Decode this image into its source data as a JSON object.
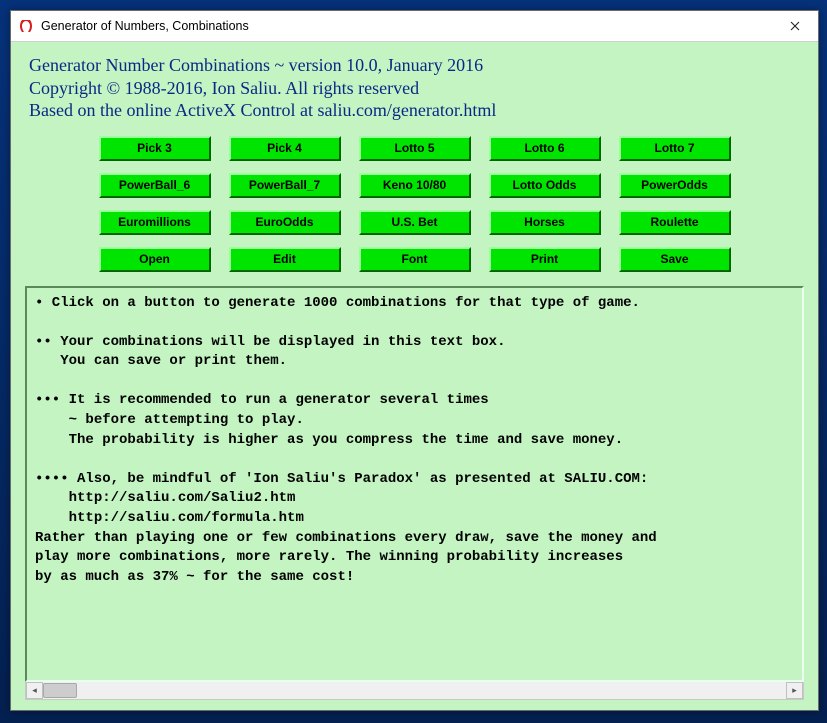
{
  "window": {
    "title": "Generator of Numbers, Combinations"
  },
  "header": {
    "line1": "Generator Number Combinations ~ version 10.0, January 2016",
    "line2": "Copyright © 1988-2016, Ion Saliu. All rights reserved",
    "line3": "Based on the online ActiveX Control at saliu.com/generator.html"
  },
  "buttons": {
    "row1": [
      "Pick 3",
      "Pick 4",
      "Lotto 5",
      "Lotto 6",
      "Lotto 7"
    ],
    "row2": [
      "PowerBall_6",
      "PowerBall_7",
      "Keno 10/80",
      "Lotto Odds",
      "PowerOdds"
    ],
    "row3": [
      "Euromillions",
      "EuroOdds",
      "U.S. Bet",
      "Horses",
      "Roulette"
    ],
    "row4": [
      "Open",
      "Edit",
      "Font",
      "Print",
      "Save"
    ]
  },
  "output_text": "• Click on a button to generate 1000 combinations for that type of game.\n\n•• Your combinations will be displayed in this text box.\n   You can save or print them.\n\n••• It is recommended to run a generator several times\n    ~ before attempting to play.\n    The probability is higher as you compress the time and save money.\n\n•••• Also, be mindful of 'Ion Saliu's Paradox' as presented at SALIU.COM:\n    http://saliu.com/Saliu2.htm\n    http://saliu.com/formula.htm\nRather than playing one or few combinations every draw, save the money and\nplay more combinations, more rarely. The winning probability increases\nby as much as 37% ~ for the same cost!",
  "colors": {
    "accent_green": "#00e500",
    "client_bg": "#c3f4c2",
    "header_text": "#0a2986"
  }
}
